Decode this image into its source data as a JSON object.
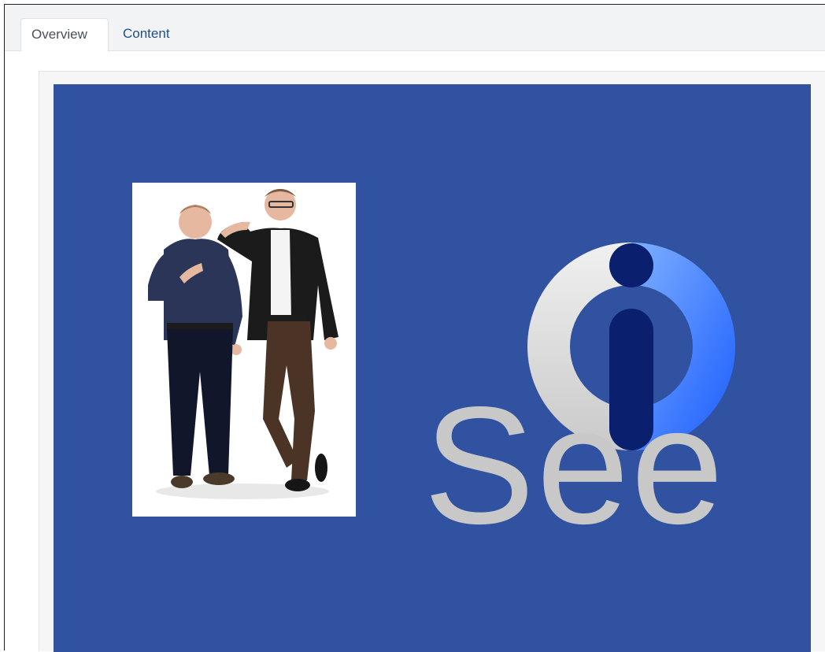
{
  "tabs": [
    {
      "label": "Overview",
      "active": true
    },
    {
      "label": "Content",
      "active": false
    }
  ],
  "slide": {
    "background_color": "#3052a0",
    "logo_text": "See",
    "logo_icon": "info-ring-icon",
    "photo_description_icon": "people-photo"
  },
  "colors": {
    "tab_active_text": "#495057",
    "tab_link_text": "#1f4e8c",
    "logo_text": "#c8c8c8",
    "logo_ring_light": "#e0e0e0",
    "logo_ring_blue": "#2f7bff",
    "logo_i_dark": "#0a1f6e"
  }
}
